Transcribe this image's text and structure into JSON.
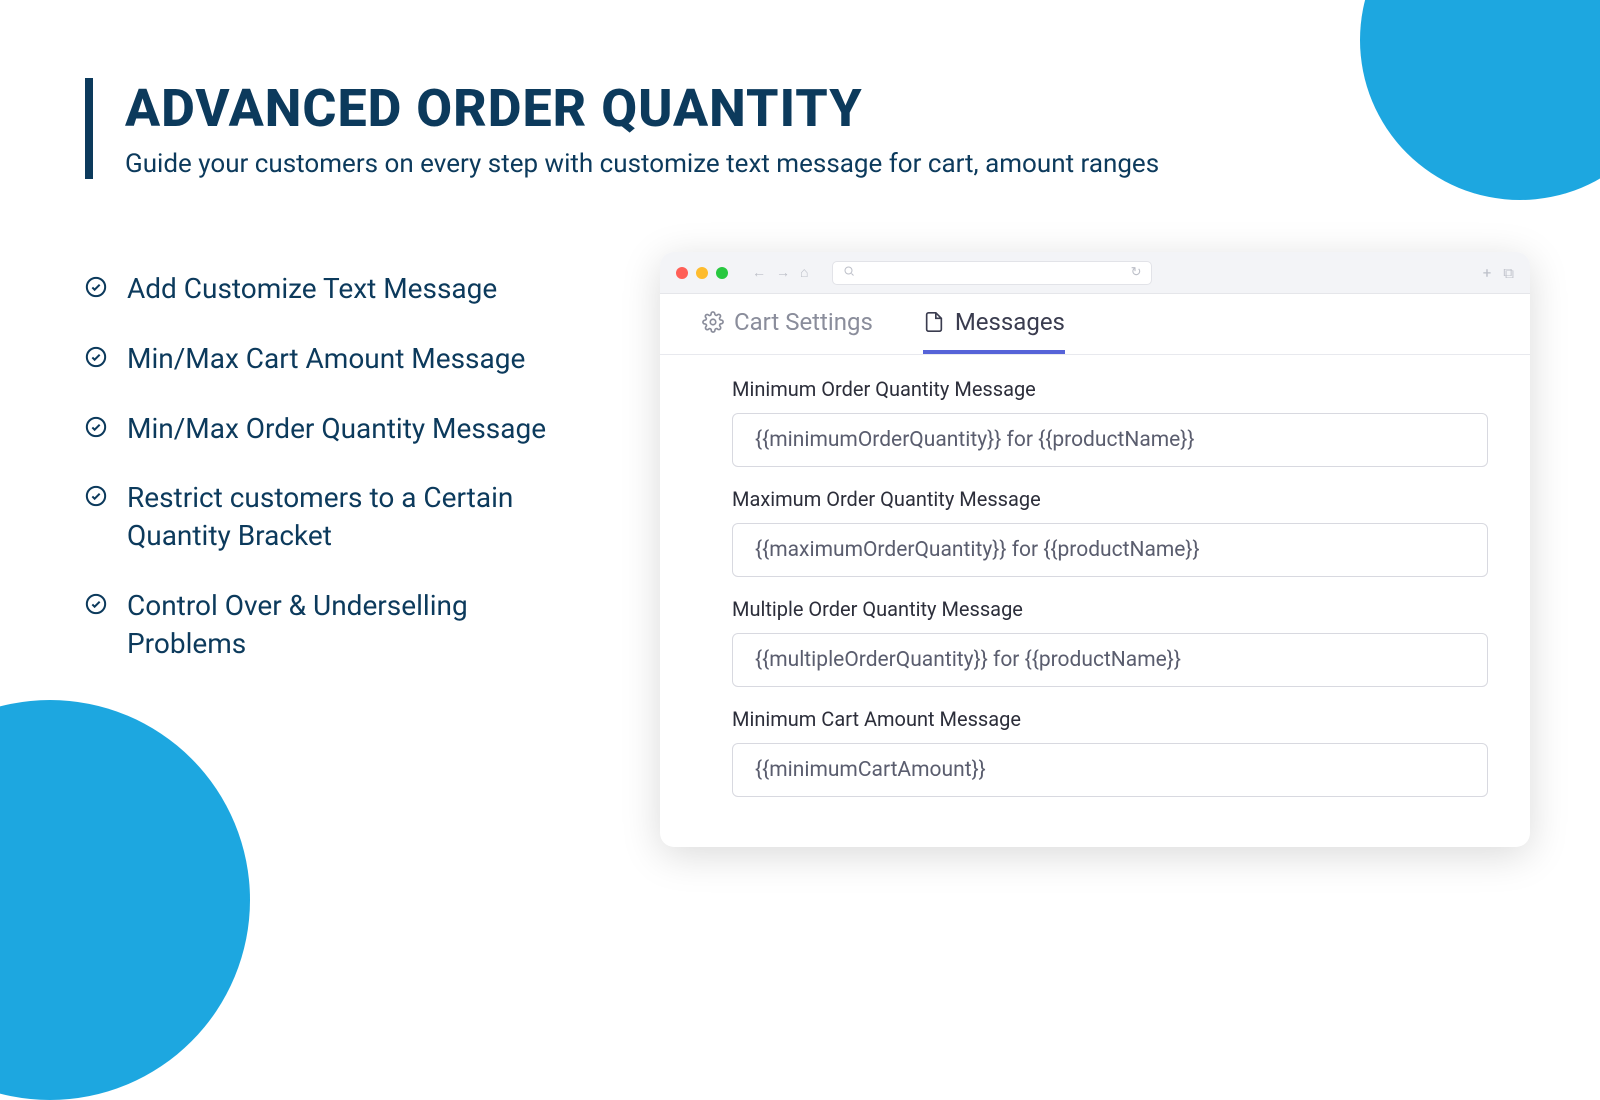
{
  "header": {
    "title": "ADVANCED ORDER QUANTITY",
    "subtitle": "Guide your customers on every step with customize text message for cart, amount ranges"
  },
  "features": [
    "Add Customize Text Message",
    "Min/Max Cart Amount Message",
    "Min/Max Order Quantity Message",
    "Restrict customers to a Certain Quantity Bracket",
    "Control  Over & Underselling Problems"
  ],
  "browser": {
    "tabs": [
      {
        "label": "Cart Settings",
        "active": false,
        "icon": "gear"
      },
      {
        "label": "Messages",
        "active": true,
        "icon": "file"
      }
    ],
    "fields": [
      {
        "label": "Minimum Order Quantity Message",
        "value": "{{minimumOrderQuantity}} for {{productName}}"
      },
      {
        "label": "Maximum Order Quantity Message",
        "value": "{{maximumOrderQuantity}} for {{productName}}"
      },
      {
        "label": "Multiple Order Quantity Message",
        "value": "{{multipleOrderQuantity}} for {{productName}}"
      },
      {
        "label": "Minimum Cart Amount Message",
        "value": "{{minimumCartAmount}}"
      }
    ]
  }
}
